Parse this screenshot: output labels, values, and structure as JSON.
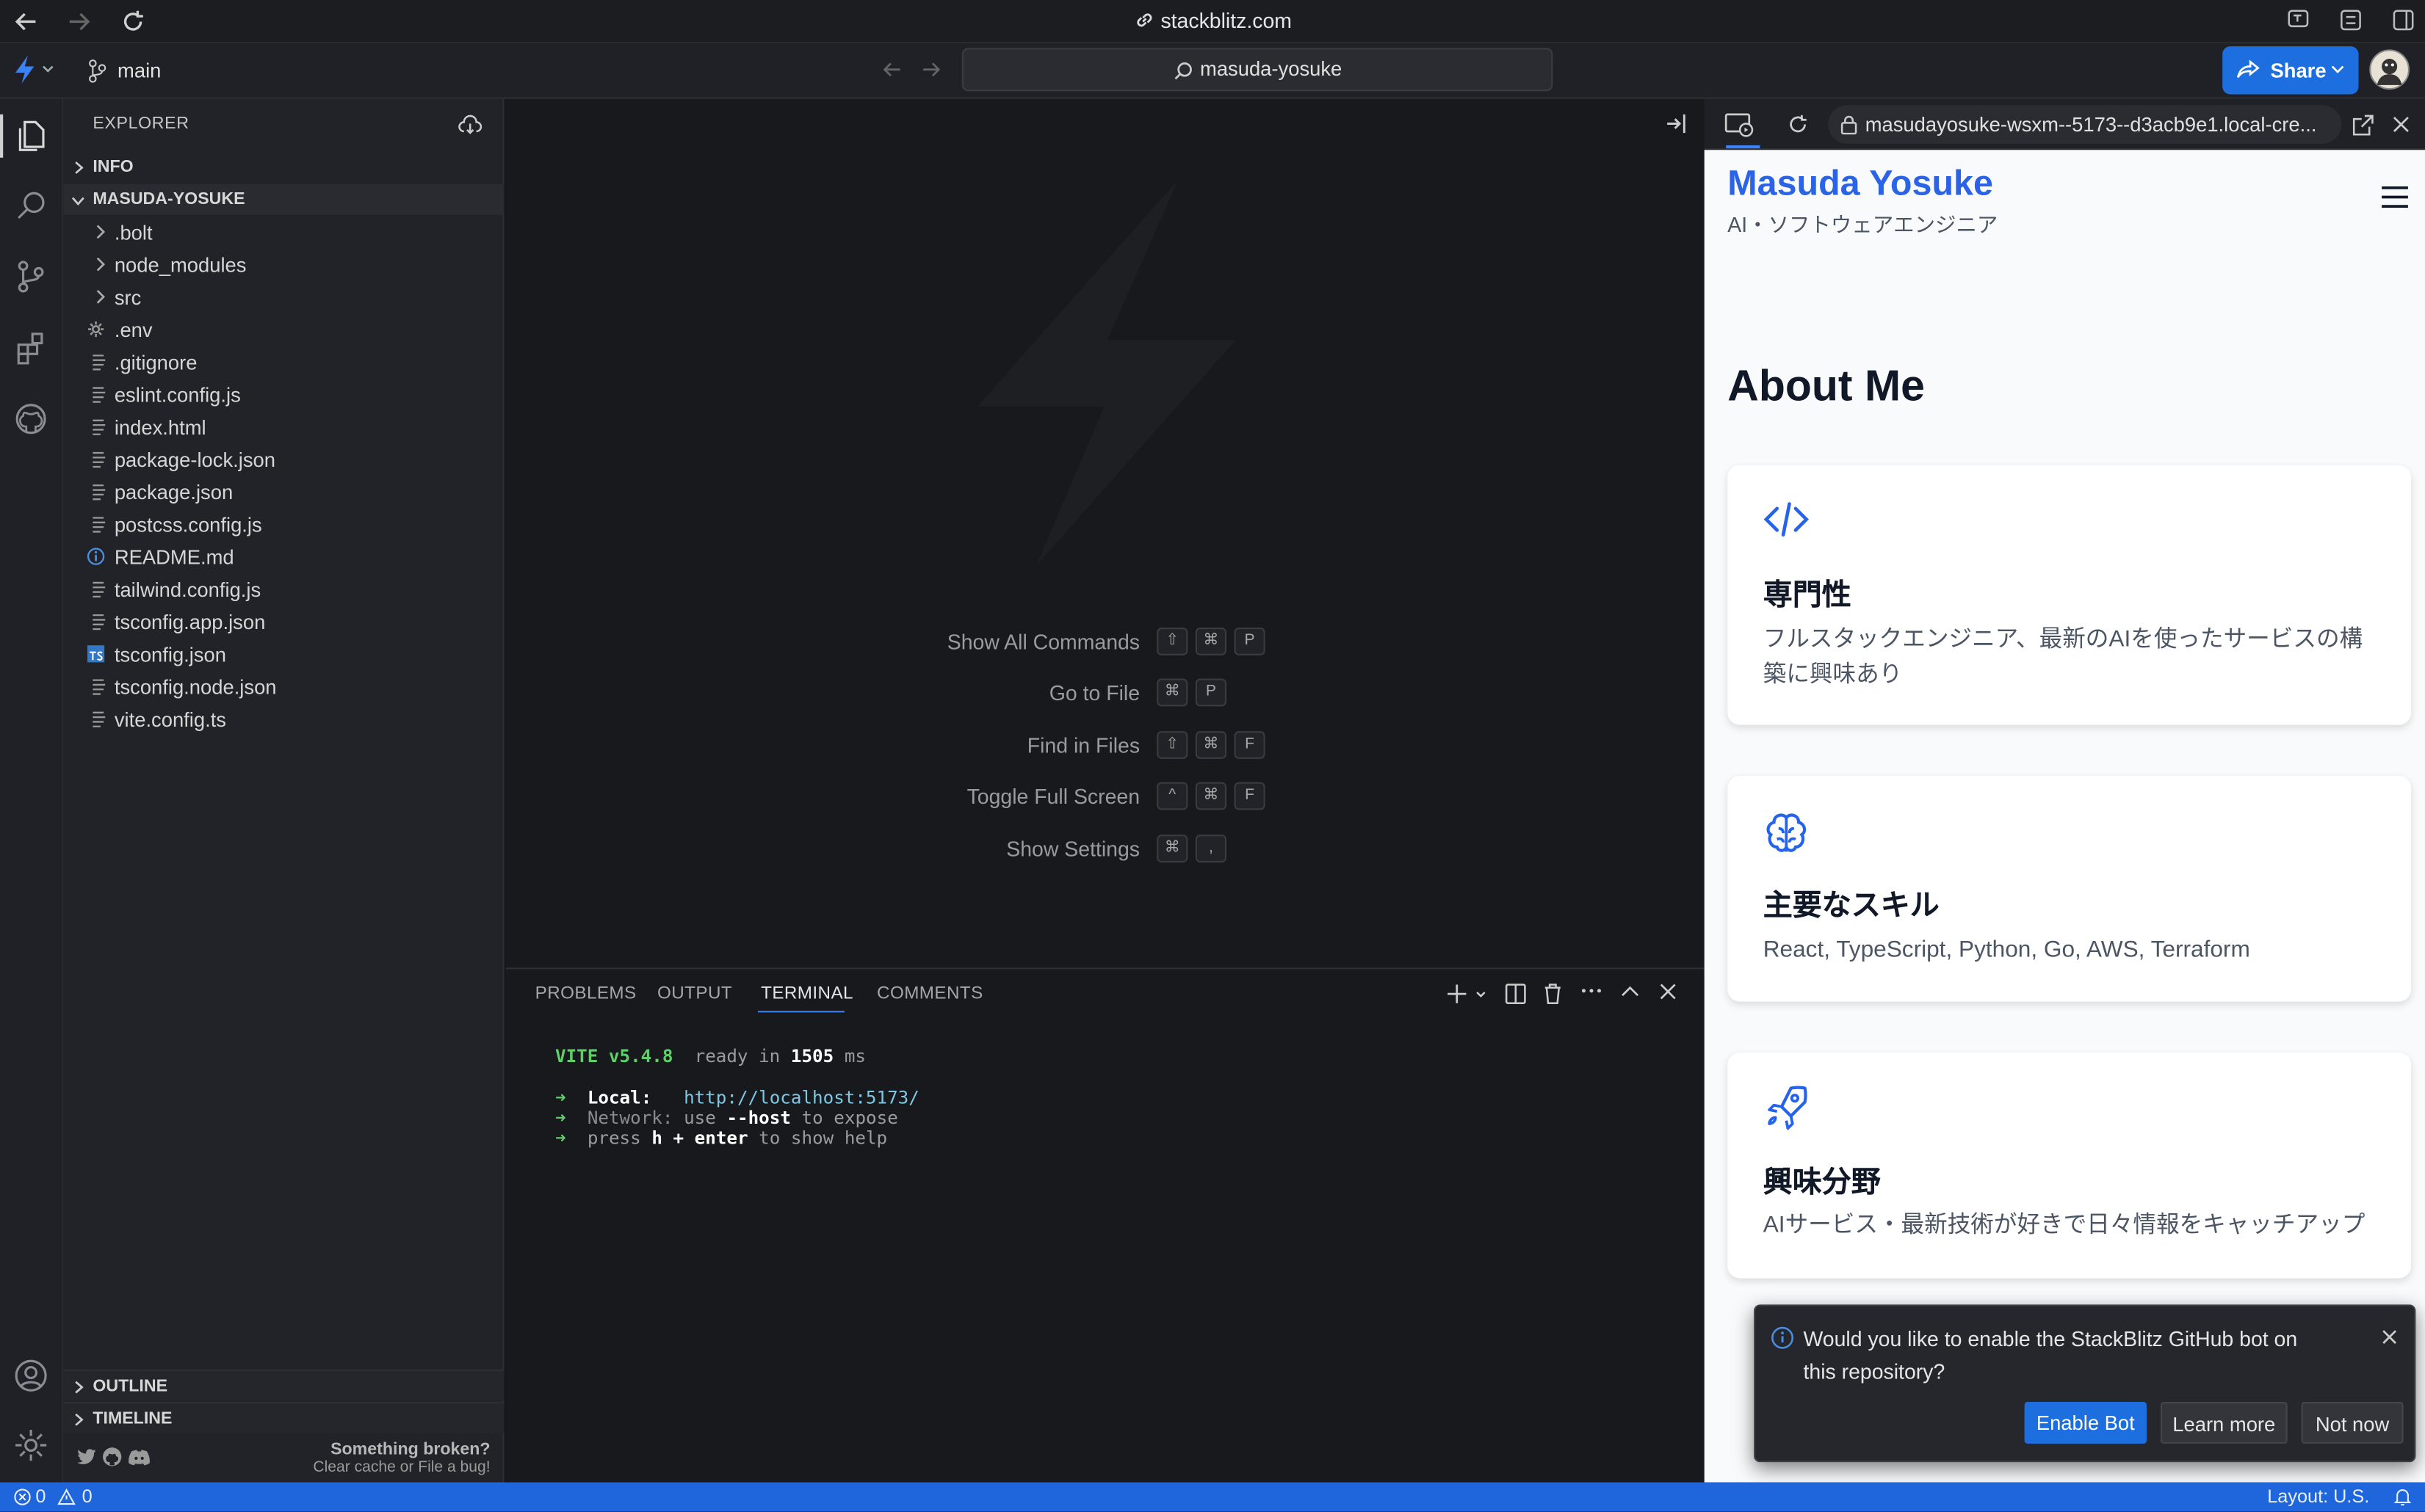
{
  "browser": {
    "domain": "stackblitz.com"
  },
  "toolbar": {
    "branch": "main",
    "search": "masuda-yosuke",
    "share_label": "Share"
  },
  "explorer": {
    "title": "EXPLORER",
    "info_section": "INFO",
    "project_section": "MASUDA-YOSUKE",
    "folders": [
      ".bolt",
      "node_modules",
      "src"
    ],
    "files": [
      ".env",
      ".gitignore",
      "eslint.config.js",
      "index.html",
      "package-lock.json",
      "package.json",
      "postcss.config.js",
      "README.md",
      "tailwind.config.js",
      "tsconfig.app.json",
      "tsconfig.json",
      "tsconfig.node.json",
      "vite.config.ts"
    ],
    "outline_section": "OUTLINE",
    "timeline_section": "TIMELINE",
    "footer_title": "Something broken?",
    "footer_sub": "Clear cache or File a bug!"
  },
  "editor": {
    "commands": [
      {
        "label": "Show All Commands",
        "keys": [
          "⇧",
          "⌘",
          "P"
        ]
      },
      {
        "label": "Go to File",
        "keys": [
          "⌘",
          "P"
        ]
      },
      {
        "label": "Find in Files",
        "keys": [
          "⇧",
          "⌘",
          "F"
        ]
      },
      {
        "label": "Toggle Full Screen",
        "keys": [
          "^",
          "⌘",
          "F"
        ]
      },
      {
        "label": "Show Settings",
        "keys": [
          "⌘",
          ","
        ]
      }
    ]
  },
  "panel": {
    "tabs": [
      "PROBLEMS",
      "OUTPUT",
      "TERMINAL",
      "COMMENTS"
    ],
    "active_tab": "TERMINAL",
    "terminal": {
      "vite": "VITE v5.4.8",
      "ready_in": "ready in",
      "ms_value": "1505",
      "ms_unit": "ms",
      "arrow": "➜",
      "local_label": "Local:",
      "local_url": "http://localhost:5173/",
      "network_label": "Network:",
      "network_use": "use",
      "network_flag": "--host",
      "network_tail": "to expose",
      "press": "press",
      "press_keys": "h + enter",
      "press_tail": "to show help"
    }
  },
  "preview": {
    "url": "masudayosuke-wsxm--5173--d3acb9e1.local-cre...",
    "brand": "Masuda Yosuke",
    "tagline": "AI・ソフトウェアエンジニア",
    "heading": "About Me",
    "cards": [
      {
        "icon": "code-icon",
        "title": "専門性",
        "desc": "フルスタックエンジニア、最新のAIを使ったサービスの構築に興味あり"
      },
      {
        "icon": "brain-icon",
        "title": "主要なスキル",
        "desc": "React, TypeScript, Python, Go, AWS, Terraform"
      },
      {
        "icon": "rocket-icon",
        "title": "興味分野",
        "desc": "AIサービス・最新技術が好きで日々情報をキャッチアップ"
      }
    ]
  },
  "toast": {
    "message": "Would you like to enable the StackBlitz GitHub bot on this repository?",
    "enable": "Enable Bot",
    "learn": "Learn more",
    "dismiss": "Not now"
  },
  "status": {
    "errors": "0",
    "warnings": "0",
    "layout": "Layout: U.S."
  },
  "colors": {
    "accent": "#1d6fe0",
    "brand": "#2a63e6",
    "status_bar": "#1f66dc",
    "terminal_green": "#5fd068",
    "terminal_link": "#7ec8e3"
  }
}
